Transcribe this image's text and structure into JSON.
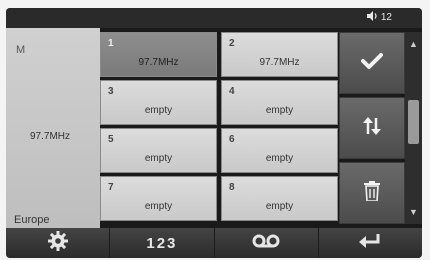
{
  "status_bar": {
    "volume_level": "12"
  },
  "left_panel": {
    "station_initial": "M",
    "frequency": "97.7MHz",
    "region": "Europe"
  },
  "presets": [
    {
      "number": "1",
      "value": "97.7MHz",
      "selected": true
    },
    {
      "number": "2",
      "value": "97.7MHz",
      "selected": false
    },
    {
      "number": "3",
      "value": "empty",
      "selected": false
    },
    {
      "number": "4",
      "value": "empty",
      "selected": false
    },
    {
      "number": "5",
      "value": "empty",
      "selected": false
    },
    {
      "number": "6",
      "value": "empty",
      "selected": false
    },
    {
      "number": "7",
      "value": "empty",
      "selected": false
    },
    {
      "number": "8",
      "value": "empty",
      "selected": false
    }
  ],
  "actions": {
    "confirm_icon": "check-icon",
    "swap_icon": "swap-arrows-icon",
    "delete_icon": "trash-icon"
  },
  "bottom_bar": {
    "settings_icon": "gear-icon",
    "keypad_label": "123",
    "radio_mode_icon": "tape-icon",
    "back_icon": "back-arrow-icon"
  },
  "colors": {
    "selected_preset": "#858585",
    "preset": "#d2d2d2",
    "action_button": "#5a5a5a",
    "bar": "#333333"
  }
}
